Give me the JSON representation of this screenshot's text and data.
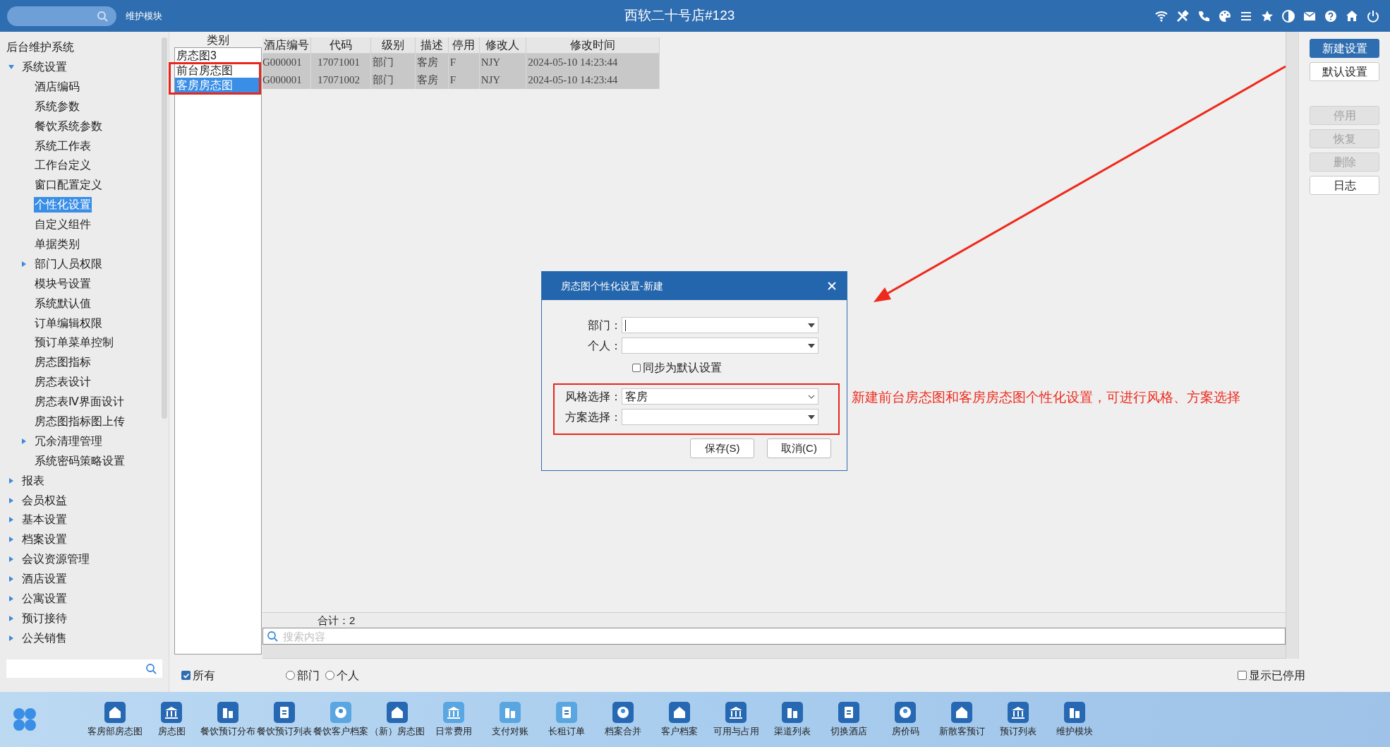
{
  "top_bar": {
    "module_label": "维护模块",
    "title": "西软二十号店#123"
  },
  "sidebar": {
    "title": "后台维护系统",
    "tree": [
      {
        "label": "系统设置",
        "kind": "branch",
        "expanded": true,
        "children": [
          {
            "label": "酒店编码",
            "kind": "leaf",
            "selected": false
          },
          {
            "label": "系统参数",
            "kind": "leaf",
            "selected": false
          },
          {
            "label": "餐饮系统参数",
            "kind": "leaf",
            "selected": false
          },
          {
            "label": "系统工作表",
            "kind": "leaf",
            "selected": false
          },
          {
            "label": "工作台定义",
            "kind": "leaf",
            "selected": false
          },
          {
            "label": "窗口配置定义",
            "kind": "leaf",
            "selected": false
          },
          {
            "label": "个性化设置",
            "kind": "leaf",
            "selected": true
          },
          {
            "label": "自定义组件",
            "kind": "leaf",
            "selected": false
          },
          {
            "label": "单据类别",
            "kind": "leaf",
            "selected": false
          },
          {
            "label": "部门人员权限",
            "kind": "branch",
            "expanded": false,
            "selected": false
          },
          {
            "label": "模块号设置",
            "kind": "leaf",
            "selected": false
          },
          {
            "label": "系统默认值",
            "kind": "leaf",
            "selected": false
          },
          {
            "label": "订单编辑权限",
            "kind": "leaf",
            "selected": false
          },
          {
            "label": "预订单菜单控制",
            "kind": "leaf",
            "selected": false
          },
          {
            "label": "房态图指标",
            "kind": "leaf",
            "selected": false
          },
          {
            "label": "房态表设计",
            "kind": "leaf",
            "selected": false
          },
          {
            "label": "房态表Ⅳ界面设计",
            "kind": "leaf",
            "selected": false
          },
          {
            "label": "房态图指标图上传",
            "kind": "leaf",
            "selected": false
          },
          {
            "label": "冗余清理管理",
            "kind": "branch",
            "expanded": false,
            "selected": false
          },
          {
            "label": "系统密码策略设置",
            "kind": "leaf",
            "selected": false
          }
        ]
      },
      {
        "label": "报表",
        "kind": "branch",
        "expanded": false
      },
      {
        "label": "会员权益",
        "kind": "branch",
        "expanded": false
      },
      {
        "label": "基本设置",
        "kind": "branch",
        "expanded": false
      },
      {
        "label": "档案设置",
        "kind": "branch",
        "expanded": false
      },
      {
        "label": "会议资源管理",
        "kind": "branch",
        "expanded": false
      },
      {
        "label": "酒店设置",
        "kind": "branch",
        "expanded": false
      },
      {
        "label": "公寓设置",
        "kind": "branch",
        "expanded": false
      },
      {
        "label": "预订接待",
        "kind": "branch",
        "expanded": false
      },
      {
        "label": "公关销售",
        "kind": "branch",
        "expanded": false
      }
    ]
  },
  "categories": {
    "header": "类别",
    "items": [
      {
        "label": "房态图3",
        "selected": false
      },
      {
        "label": "前台房态图",
        "selected": false
      },
      {
        "label": "客房房态图",
        "selected": true
      }
    ]
  },
  "table": {
    "columns": [
      "酒店编号",
      "代码",
      "级别",
      "描述",
      "停用",
      "修改人",
      "修改时间"
    ],
    "rows": [
      [
        "G000001",
        "17071001",
        "部门",
        "客房",
        "F",
        "NJY",
        "2024-05-10 14:23:44"
      ],
      [
        "G000001",
        "17071002",
        "部门",
        "客房",
        "F",
        "NJY",
        "2024-05-10 14:23:44"
      ]
    ],
    "total": "合计：2",
    "search_placeholder": "搜索内容"
  },
  "filters": [
    {
      "label": "所有",
      "kind": "checkbox",
      "checked": true
    },
    {
      "label": "部门",
      "kind": "radio",
      "checked": false
    },
    {
      "label": "个人",
      "kind": "radio",
      "checked": false
    }
  ],
  "show_disabled": {
    "label": "显示已停用",
    "checked": false
  },
  "actions": [
    {
      "label": "新建设置",
      "primary": true,
      "disabled": false
    },
    {
      "label": "默认设置",
      "primary": false,
      "disabled": false
    },
    {
      "label": "停用",
      "primary": false,
      "disabled": true
    },
    {
      "label": "恢复",
      "primary": false,
      "disabled": true
    },
    {
      "label": "删除",
      "primary": false,
      "disabled": true
    },
    {
      "label": "日志",
      "primary": false,
      "disabled": false
    }
  ],
  "dialog": {
    "title": "房态图个性化设置-新建",
    "fields_top": [
      {
        "label": "部门："
      },
      {
        "label": "个人："
      }
    ],
    "sync_checkbox": {
      "label": "同步为默认设置",
      "checked": false
    },
    "fields_style": [
      {
        "label": "风格选择：",
        "value": "客房"
      },
      {
        "label": "方案选择："
      }
    ],
    "buttons": [
      "保存(S)",
      "取消(C)"
    ]
  },
  "annotation": "新建前台房态图和客房房态图个性化设置，可进行风格、方案选择",
  "taskbar": [
    "客房部房态图",
    "房态图",
    "餐饮预订分布",
    "餐饮预订列表",
    "餐饮客户档案",
    "（新）房态图",
    "日常费用",
    "支付对账",
    "长租订单",
    "档案合并",
    "客户档案",
    "可用与占用",
    "渠道列表",
    "切换酒店",
    "房价码",
    "新散客预订",
    "预订列表",
    "维护模块"
  ]
}
